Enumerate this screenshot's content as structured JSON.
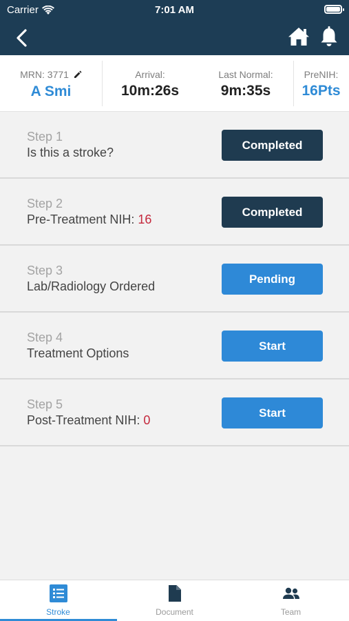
{
  "status": {
    "carrier": "Carrier",
    "time": "7:01 AM"
  },
  "header": {
    "mrn_label": "MRN: 3771",
    "patient_name": "A Smi",
    "arrival_label": "Arrival:",
    "arrival_value": "10m:26s",
    "last_normal_label": "Last Normal:",
    "last_normal_value": "9m:35s",
    "prenih_label": "PreNIH:",
    "prenih_value": "16Pts"
  },
  "steps": [
    {
      "number": "Step 1",
      "title": "Is this a stroke?",
      "score": "",
      "button": "Completed",
      "state": "completed"
    },
    {
      "number": "Step 2",
      "title": "Pre-Treatment NIH: ",
      "score": "16",
      "button": "Completed",
      "state": "completed"
    },
    {
      "number": "Step 3",
      "title": "Lab/Radiology Ordered",
      "score": "",
      "button": "Pending",
      "state": "pending"
    },
    {
      "number": "Step 4",
      "title": "Treatment Options",
      "score": "",
      "button": "Start",
      "state": "start"
    },
    {
      "number": "Step 5",
      "title": "Post-Treatment NIH: ",
      "score": "0",
      "button": "Start",
      "state": "start"
    }
  ],
  "tabs": [
    {
      "label": "Stroke",
      "icon": "list-icon",
      "active": true
    },
    {
      "label": "Document",
      "icon": "document-icon",
      "active": false
    },
    {
      "label": "Team",
      "icon": "team-icon",
      "active": false
    }
  ],
  "colors": {
    "navbar": "#1d3d55",
    "accent": "#2f8bd6",
    "completed": "#1f3b50",
    "score": "#c4283c"
  }
}
